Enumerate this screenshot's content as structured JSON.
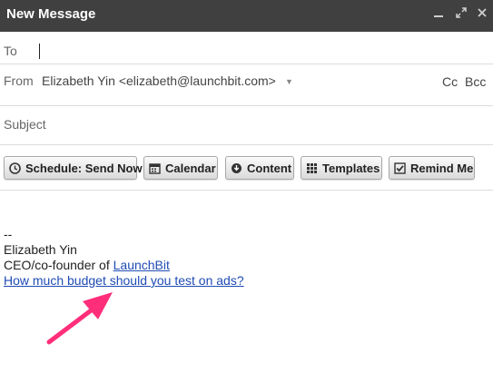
{
  "window": {
    "title": "New Message",
    "minimize_icon": "minimize-icon",
    "popout_icon": "popout-icon",
    "close_icon": "close-icon"
  },
  "fields": {
    "to_label": "To",
    "from_label": "From",
    "from_value": "Elizabeth Yin <elizabeth@launchbit.com>",
    "cc_label": "Cc",
    "bcc_label": "Bcc",
    "subject_label": "Subject"
  },
  "toolbar": {
    "buttons": [
      {
        "label": "Schedule: Send Now",
        "icon": "clock-icon"
      },
      {
        "label": "Calendar",
        "icon": "calendar-icon"
      },
      {
        "label": "Content",
        "icon": "download-icon"
      },
      {
        "label": "Templates",
        "icon": "grid-icon"
      },
      {
        "label": "Remind Me",
        "icon": "checkbox-icon"
      }
    ]
  },
  "signature": {
    "dash": "--",
    "name": "Elizabeth Yin",
    "title_prefix": "CEO/co-founder of ",
    "company_link": "LaunchBit",
    "promo_link": "How much budget should you test on ads?"
  },
  "colors": {
    "titlebar": "#404040",
    "link": "#1f4bb4",
    "annotation_arrow": "#ff2e7a"
  }
}
